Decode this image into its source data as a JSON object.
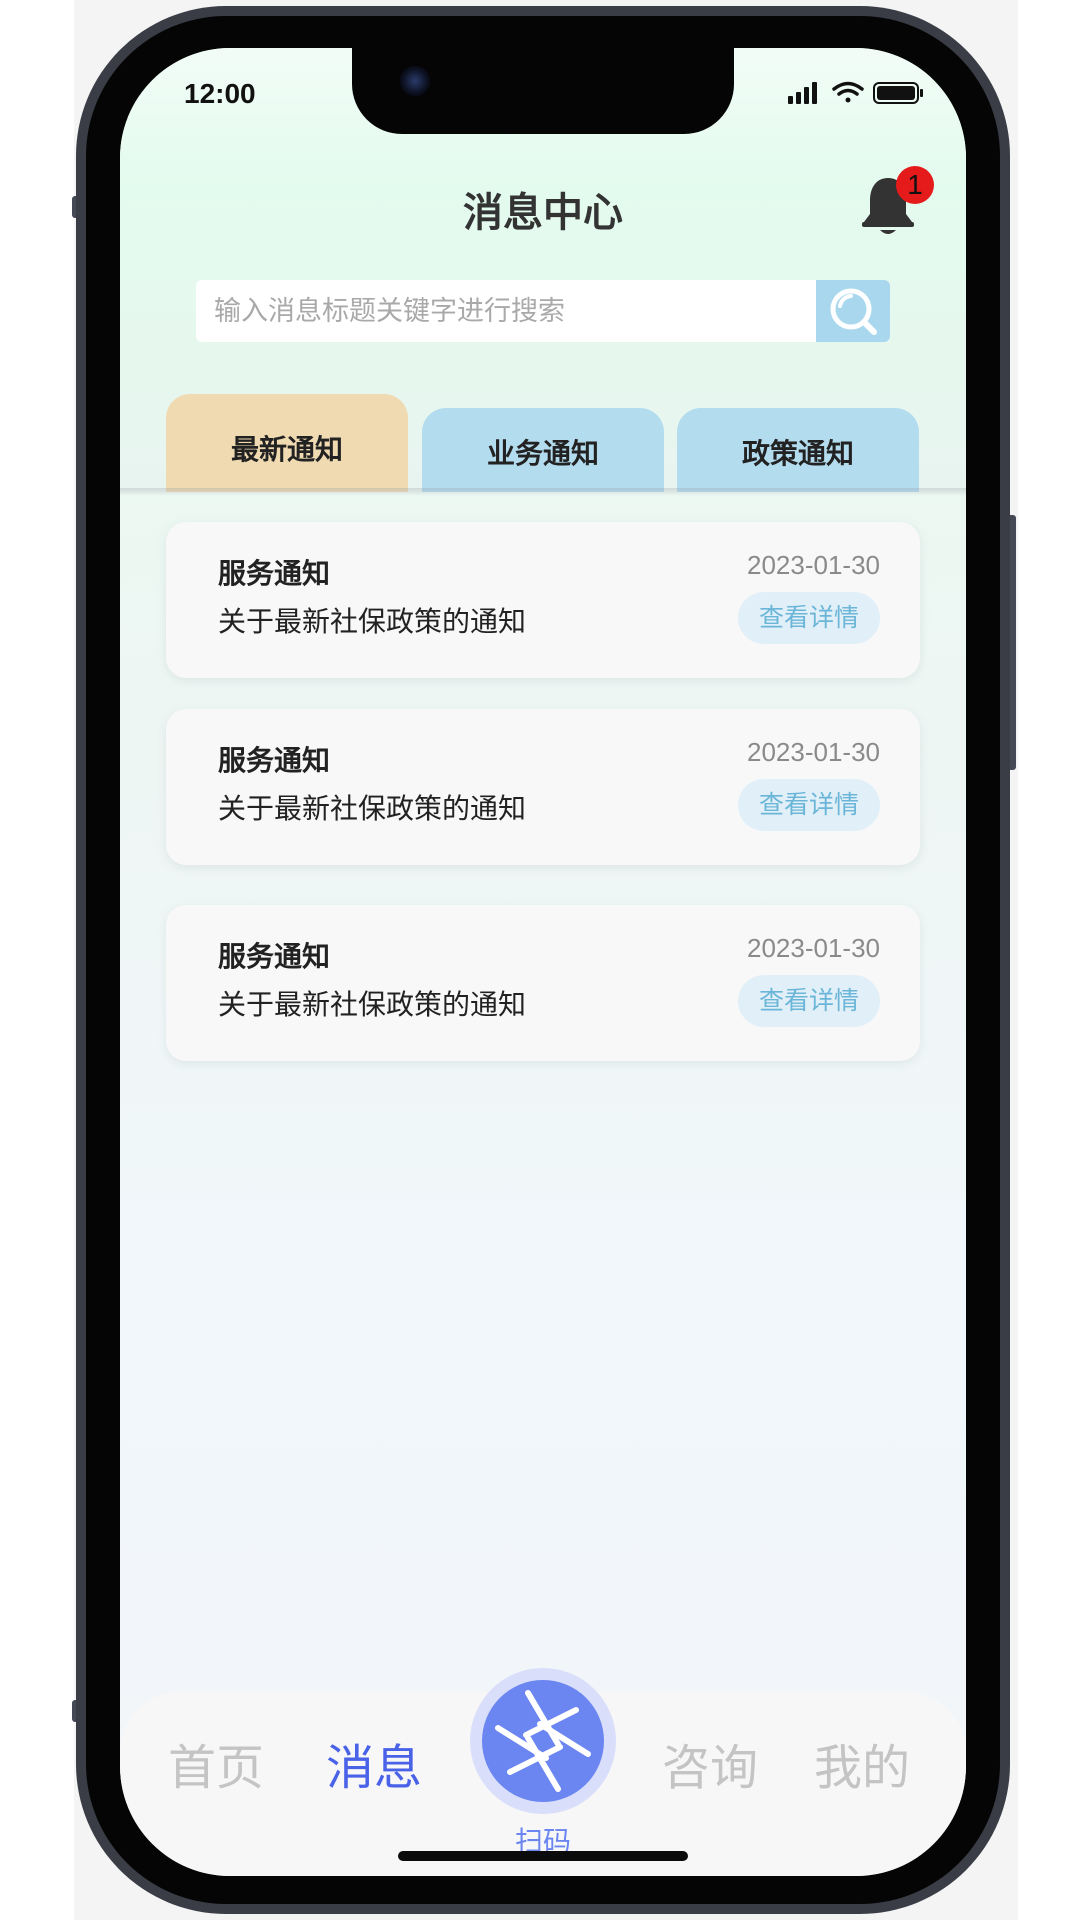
{
  "status_bar": {
    "time": "12:00"
  },
  "header": {
    "title": "消息中心",
    "notification_count": "1"
  },
  "search": {
    "placeholder": "输入消息标题关键字进行搜索"
  },
  "tabs": [
    {
      "label": "最新通知",
      "active": true
    },
    {
      "label": "业务通知",
      "active": false
    },
    {
      "label": "政策通知",
      "active": false
    }
  ],
  "messages": [
    {
      "title": "服务通知",
      "description": "关于最新社保政策的通知",
      "date": "2023-01-30",
      "action": "查看详情"
    },
    {
      "title": "服务通知",
      "description": "关于最新社保政策的通知",
      "date": "2023-01-30",
      "action": "查看详情"
    },
    {
      "title": "服务通知",
      "description": "关于最新社保政策的通知",
      "date": "2023-01-30",
      "action": "查看详情"
    }
  ],
  "bottom_nav": {
    "items": [
      {
        "label": "首页",
        "active": false
      },
      {
        "label": "消息",
        "active": true
      },
      {
        "label": "咨询",
        "active": false
      },
      {
        "label": "我的",
        "active": false
      }
    ],
    "scan_label": "扫码"
  },
  "colors": {
    "active_tab": "#f0dab1",
    "inactive_tab": "#b3dcef",
    "accent": "#4a62e8",
    "scan_button": "#6b86f0",
    "badge": "#e51a1a",
    "detail_button_text": "#6bb6d8"
  },
  "icons": {
    "bell": "bell-icon",
    "search": "search-icon",
    "scan": "aperture-scan-icon"
  }
}
